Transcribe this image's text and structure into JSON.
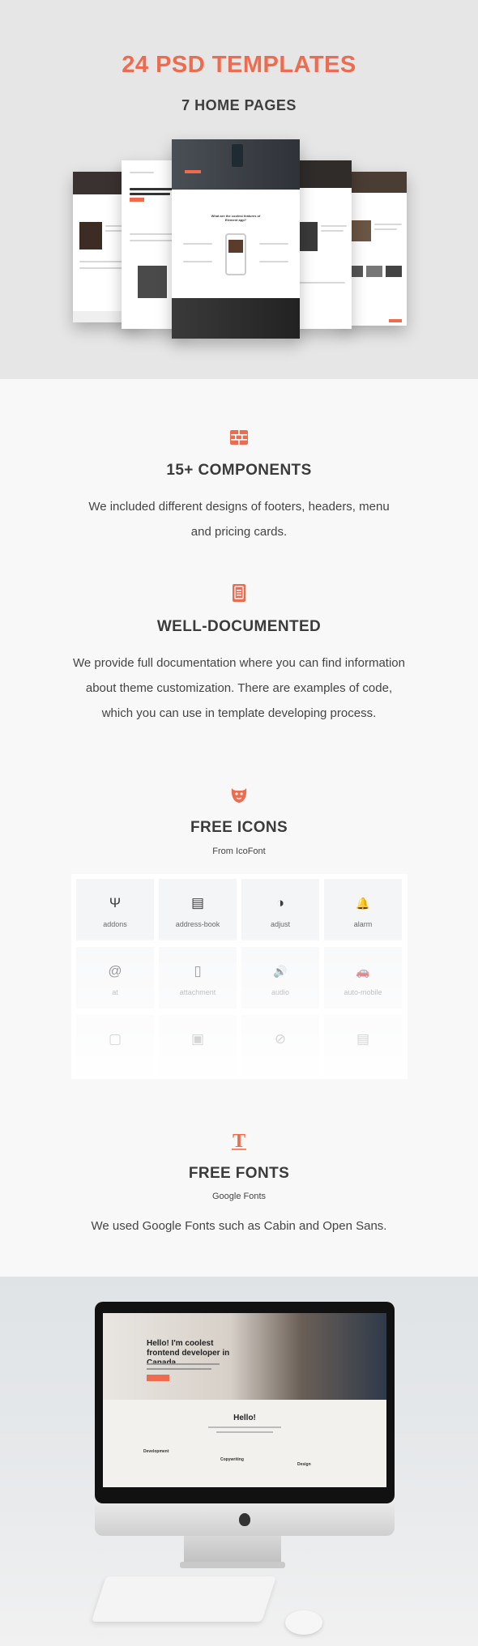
{
  "hero": {
    "title": "24 PSD TEMPLATES",
    "subtitle": "7 HOME PAGES",
    "mockups": {
      "center_heading": "What are the coolest features of Element app?",
      "left_heading": "Hello! I'm coolest frontend developer in Canada"
    }
  },
  "components": {
    "icon": "grid-icon",
    "title": "15+ COMPONENTS",
    "text": "We included different designs of footers, headers, menu and pricing cards."
  },
  "documented": {
    "icon": "book-icon",
    "title": "WELL-DOCUMENTED",
    "text": "We provide full documentation where you can find information about theme customization.  There are examples of code, which you can use in template developing process."
  },
  "icons": {
    "icon": "beard-icon",
    "title": "FREE ICONS",
    "source": "From IcoFont",
    "items": [
      {
        "name": "addons",
        "glyph": "Ψ"
      },
      {
        "name": "address-book",
        "glyph": "▤"
      },
      {
        "name": "adjust",
        "glyph": "◑"
      },
      {
        "name": "alarm",
        "glyph": "🔔"
      },
      {
        "name": "at",
        "glyph": "@"
      },
      {
        "name": "attachment",
        "glyph": "▯"
      },
      {
        "name": "audio",
        "glyph": "🔊"
      },
      {
        "name": "auto-mobile",
        "glyph": "🚗"
      },
      {
        "name": "",
        "glyph": "▢"
      },
      {
        "name": "",
        "glyph": "▣"
      },
      {
        "name": "",
        "glyph": "⊘"
      },
      {
        "name": "",
        "glyph": "▤"
      }
    ]
  },
  "fonts": {
    "icon": "type-icon",
    "title": "FREE FONTS",
    "source": "Google Fonts",
    "text": "We used Google Fonts such as Cabin and Open Sans."
  },
  "showcase": {
    "screen_heading": "Hello! I'm coolest frontend developer in Canada",
    "screen_hello": "Hello!",
    "screen_labels": [
      "Development",
      "Copywriting",
      "Design"
    ]
  },
  "colors": {
    "accent": "#ef6b4d",
    "heading": "#3b3b3b",
    "body": "#444444",
    "hero_bg": "#e6e6e6",
    "page_bg": "#f8f8f8"
  }
}
